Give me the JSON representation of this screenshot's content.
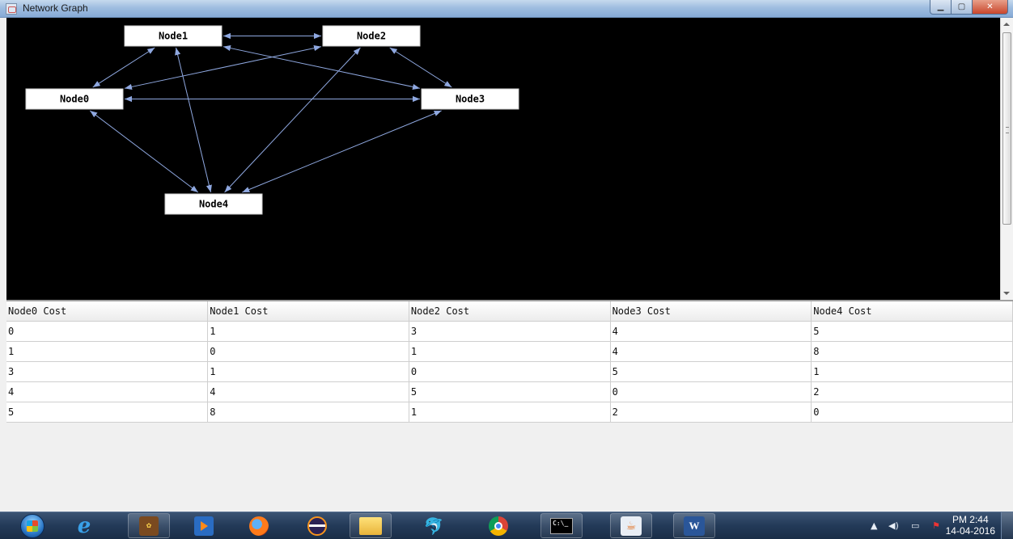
{
  "window": {
    "title": "Network Graph"
  },
  "graph": {
    "nodes": [
      {
        "id": "node1",
        "label": "Node1"
      },
      {
        "id": "node2",
        "label": "Node2"
      },
      {
        "id": "node0",
        "label": "Node0"
      },
      {
        "id": "node3",
        "label": "Node3"
      },
      {
        "id": "node4",
        "label": "Node4"
      }
    ],
    "edges": [
      [
        "Node1",
        "Node2"
      ],
      [
        "Node1",
        "Node0"
      ],
      [
        "Node1",
        "Node3"
      ],
      [
        "Node1",
        "Node4"
      ],
      [
        "Node2",
        "Node0"
      ],
      [
        "Node2",
        "Node3"
      ],
      [
        "Node2",
        "Node4"
      ],
      [
        "Node0",
        "Node3"
      ],
      [
        "Node0",
        "Node4"
      ],
      [
        "Node3",
        "Node4"
      ]
    ],
    "colors": {
      "background": "#000000",
      "edge": "#8fa8e0",
      "node_fill": "#ffffff"
    }
  },
  "table": {
    "headers": [
      "Node0 Cost",
      "Node1 Cost",
      "Node2 Cost",
      "Node3 Cost",
      "Node4 Cost"
    ],
    "rows": [
      [
        "0",
        "1",
        "3",
        "4",
        "5"
      ],
      [
        "1",
        "0",
        "1",
        "4",
        "8"
      ],
      [
        "3",
        "1",
        "0",
        "5",
        "1"
      ],
      [
        "4",
        "4",
        "5",
        "0",
        "2"
      ],
      [
        "5",
        "8",
        "1",
        "2",
        "0"
      ]
    ]
  },
  "taskbar": {
    "apps": [
      "start-button",
      "internet-explorer",
      "netbeans-ide",
      "media-player",
      "firefox",
      "eclipse",
      "file-explorer",
      "mysql",
      "chrome",
      "command-prompt",
      "java",
      "microsoft-word"
    ],
    "clock": {
      "time": "PM 2:44",
      "date": "14-04-2016"
    }
  }
}
